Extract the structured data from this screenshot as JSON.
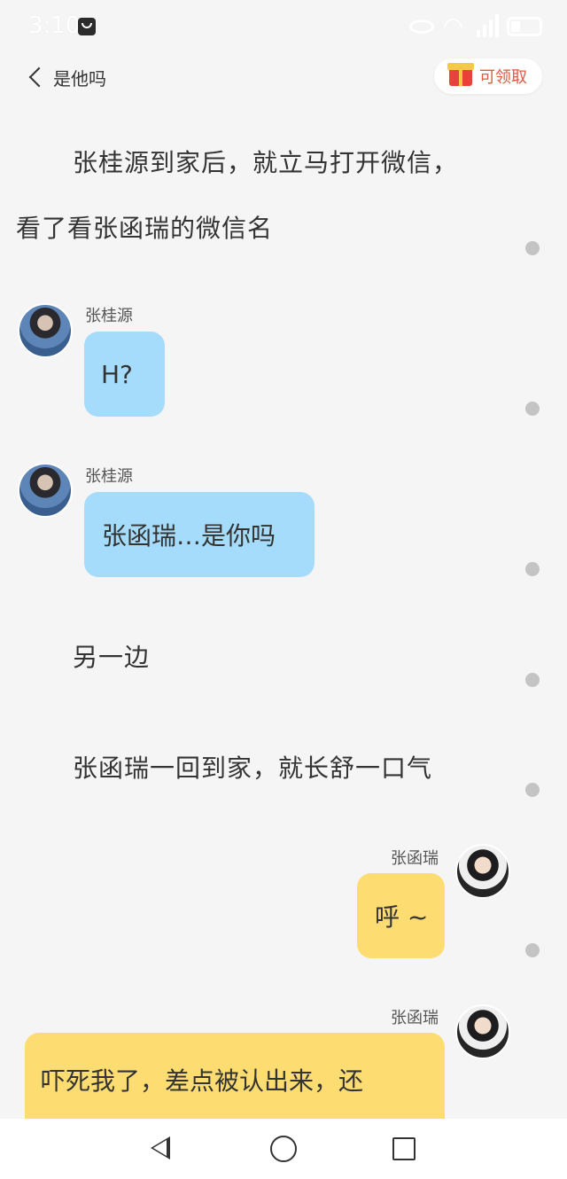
{
  "status_bar": {
    "time": "3:10"
  },
  "header": {
    "back_label": "是他吗",
    "reward_label": "可领取"
  },
  "story": [
    {
      "text": "张桂源到家后，就立马打开微信，"
    },
    {
      "text": "看了看张函瑞的微信名"
    },
    {
      "text": "另一边"
    },
    {
      "text": "张函瑞一回到家，就长舒一口气"
    }
  ],
  "messages": [
    {
      "sender": "张桂源",
      "text": "H?"
    },
    {
      "sender": "张桂源",
      "text": "张函瑞…是你吗"
    },
    {
      "sender": "张函瑞",
      "text": "呼 ~"
    },
    {
      "sender": "张函瑞",
      "text": "吓死我了，差点被认出来，还"
    }
  ],
  "colors": {
    "bubble_left": "#a6dcfb",
    "bubble_right": "#fddd71",
    "reward_text": "#e05a3e"
  },
  "icons": [
    "back-chevron-icon",
    "gift-icon",
    "nav-back-icon",
    "nav-home-icon",
    "nav-recent-icon"
  ]
}
